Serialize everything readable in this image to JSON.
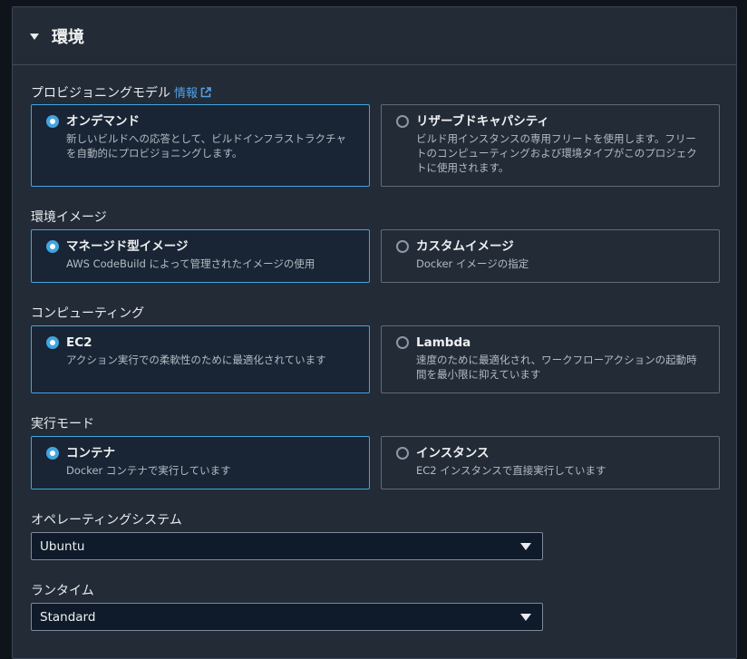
{
  "section": {
    "title": "環境"
  },
  "provisioning": {
    "label": "プロビジョニングモデル",
    "info_link": "情報",
    "options": [
      {
        "title": "オンデマンド",
        "desc": "新しいビルドへの応答として、ビルドインフラストラクチャを自動的にプロビジョニングします。",
        "selected": true
      },
      {
        "title": "リザーブドキャパシティ",
        "desc": "ビルド用インスタンスの専用フリートを使用します。フリートのコンピューティングおよび環境タイプがこのプロジェクトに使用されます。",
        "selected": false
      }
    ]
  },
  "image": {
    "label": "環境イメージ",
    "options": [
      {
        "title": "マネージド型イメージ",
        "desc": "AWS CodeBuild によって管理されたイメージの使用",
        "selected": true
      },
      {
        "title": "カスタムイメージ",
        "desc": "Docker イメージの指定",
        "selected": false
      }
    ]
  },
  "compute": {
    "label": "コンピューティング",
    "options": [
      {
        "title": "EC2",
        "desc": "アクション実行での柔軟性のために最適化されています",
        "selected": true
      },
      {
        "title": "Lambda",
        "desc": "速度のために最適化され、ワークフローアクションの起動時間を最小限に抑えています",
        "selected": false
      }
    ]
  },
  "run_mode": {
    "label": "実行モード",
    "options": [
      {
        "title": "コンテナ",
        "desc": "Docker コンテナで実行しています",
        "selected": true
      },
      {
        "title": "インスタンス",
        "desc": "EC2 インスタンスで直接実行しています",
        "selected": false
      }
    ]
  },
  "os": {
    "label": "オペレーティングシステム",
    "value": "Ubuntu"
  },
  "runtime": {
    "label": "ランタイム",
    "value": "Standard"
  },
  "colors": {
    "accent": "#42a5e0",
    "link": "#539fe5",
    "panel": "#232b37"
  },
  "icons": {
    "collapse": "caret-down-icon",
    "external": "external-link-icon",
    "dropdown": "chevron-down-icon"
  }
}
